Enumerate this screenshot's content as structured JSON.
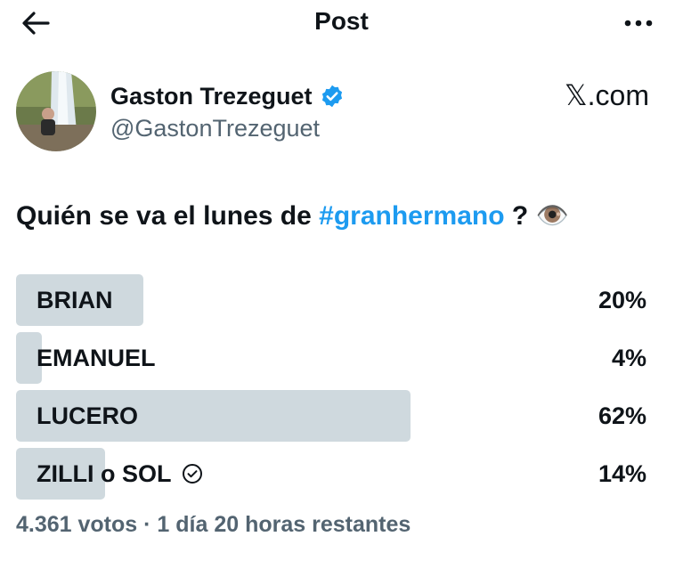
{
  "header": {
    "title": "Post",
    "back_icon": "arrow-left-icon",
    "more_icon": "more-horizontal-icon"
  },
  "author": {
    "display_name": "Gaston Trezeguet",
    "handle": "@GastonTrezeguet",
    "verified": true,
    "verified_color": "#1d9bf0"
  },
  "source": "𝕏.com",
  "post": {
    "text_before": "Quién se va el lunes de ",
    "hashtag": "#granhermano",
    "text_after": " ? 👁️"
  },
  "poll": {
    "bar_color": "#cfd9de",
    "options": [
      {
        "label": "BRIAN",
        "percent": "20%",
        "fraction": 0.2,
        "selected": false
      },
      {
        "label": "EMANUEL",
        "percent": "4%",
        "fraction": 0.04,
        "selected": false
      },
      {
        "label": "LUCERO",
        "percent": "62%",
        "fraction": 0.62,
        "selected": false
      },
      {
        "label": "ZILLI o SOL",
        "percent": "14%",
        "fraction": 0.14,
        "selected": true
      }
    ],
    "footer": "4.361 votos · 1 día 20 horas restantes"
  }
}
